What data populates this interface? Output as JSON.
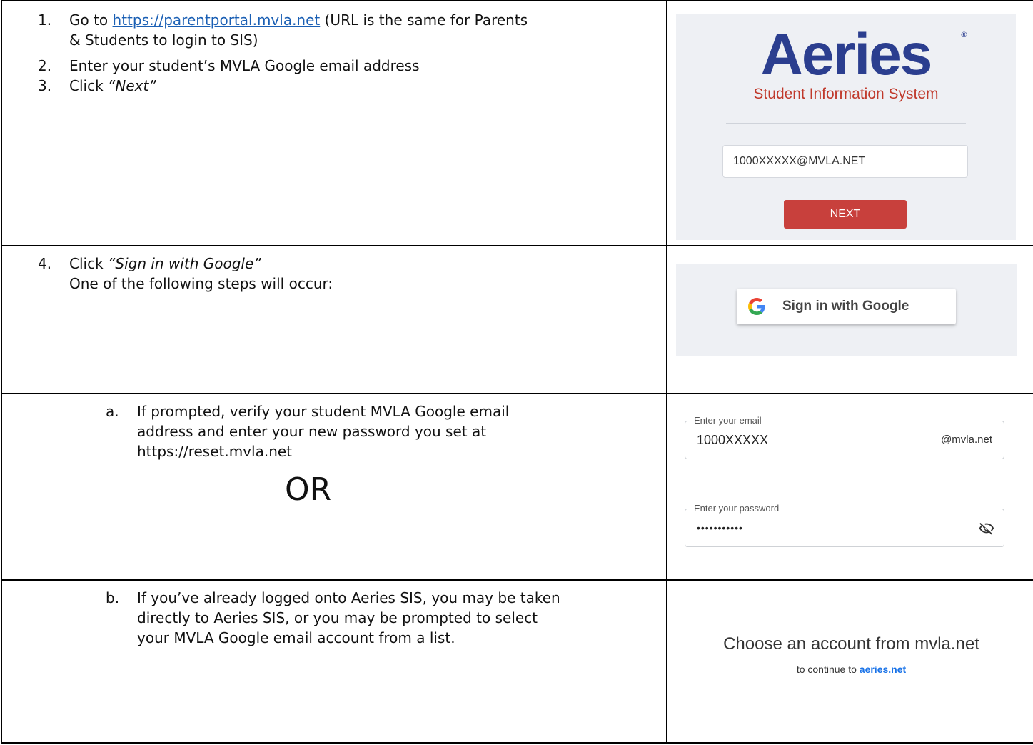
{
  "row1": {
    "steps": [
      {
        "num": "1.",
        "pre": "Go to ",
        "link": "https://parentportal.mvla.net",
        "post": "  (URL is the same for Parents",
        "line2": "& Students to login to SIS)"
      },
      {
        "num": "2.",
        "text": "Enter your student’s MVLA Google email address"
      },
      {
        "num": "3.",
        "pre": "Click ",
        "em": "“Next”"
      }
    ],
    "panel": {
      "logo": "Aeries",
      "reg": "®",
      "subtitle": "Student Information System",
      "email_value": "1000XXXXX@MVLA.NET",
      "next_label": "NEXT"
    }
  },
  "row2": {
    "step": {
      "num": "4.",
      "pre": "Click ",
      "em": "“Sign in with Google”",
      "line2": "One of the following steps will occur:"
    },
    "panel": {
      "button_label": "Sign in with Google"
    }
  },
  "row3": {
    "step": {
      "num": "a.",
      "line1": "If prompted, verify your student MVLA Google email",
      "line2": "address and enter your new password you set at",
      "line3": "https://reset.mvla.net"
    },
    "or": "OR",
    "panel": {
      "email_label": "Enter your email",
      "email_value": "1000XXXXX",
      "email_suffix": "@mvla.net",
      "password_label": "Enter your password",
      "password_value": "•••••••••••"
    }
  },
  "row4": {
    "step": {
      "num": "b.",
      "line1": "If you’ve already logged onto Aeries SIS, you may be taken",
      "line2": "directly to Aeries SIS, or you may be prompted to select",
      "line3": "your MVLA Google email account from a list."
    },
    "panel": {
      "title": "Choose an account from mvla.net",
      "continue_pre": "to continue to ",
      "continue_link": "aeries.net"
    }
  }
}
